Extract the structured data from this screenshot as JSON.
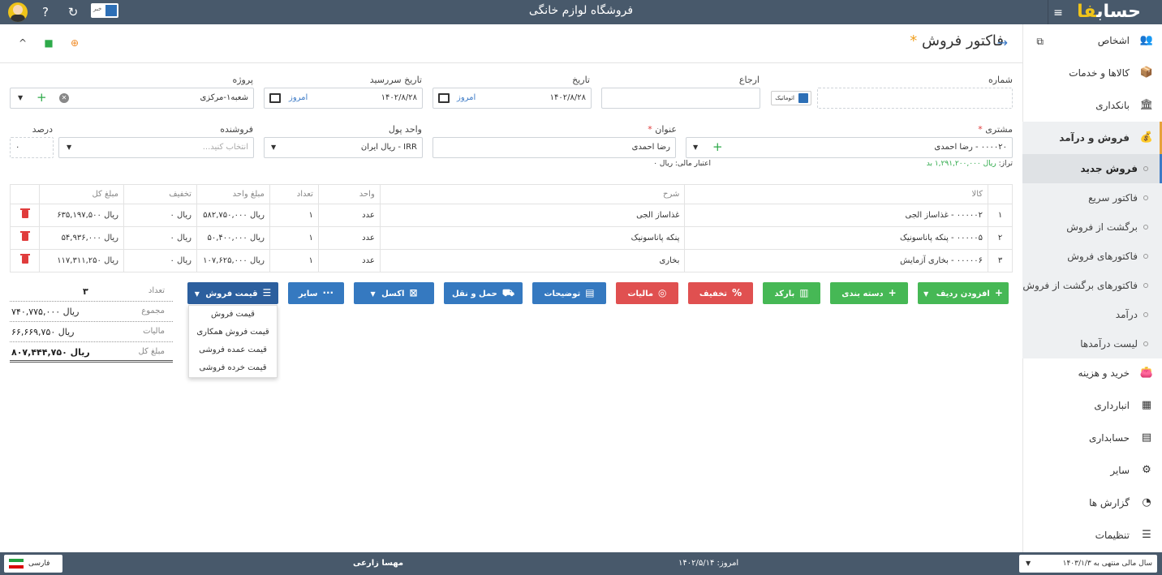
{
  "topbar": {
    "title": "فروشگاه لوازم خانگی",
    "logo": "حساب",
    "logo_highlight": "فا",
    "lang_badge": "خبر"
  },
  "sidebar": {
    "items": [
      {
        "label": "اشخاص",
        "icon": "people-icon"
      },
      {
        "label": "کالاها و خدمات",
        "icon": "box-icon"
      },
      {
        "label": "بانکداری",
        "icon": "bank-icon"
      },
      {
        "label": "فروش و درآمد",
        "icon": "sales-icon"
      },
      {
        "label": "خرید و هزینه",
        "icon": "wallet-icon"
      },
      {
        "label": "انبارداری",
        "icon": "warehouse-icon"
      },
      {
        "label": "حسابداری",
        "icon": "ledger-icon"
      },
      {
        "label": "سایر",
        "icon": "robot-icon"
      },
      {
        "label": "گزارش ها",
        "icon": "chart-icon"
      },
      {
        "label": "تنظیمات",
        "icon": "sliders-icon"
      }
    ],
    "sub": [
      "فروش جدید",
      "فاکتور سریع",
      "برگشت از فروش",
      "فاکتورهای فروش",
      "فاکتورهای برگشت از فروش",
      "درآمد",
      "لیست درآمدها"
    ]
  },
  "page": {
    "title": "فاکتور فروش",
    "star": "*"
  },
  "form": {
    "number_label": "شماره",
    "ref_label": "ارجاع",
    "auto_label": "اتوماتیک",
    "date_label": "تاریخ",
    "date_value": "۱۴۰۲/۸/۲۸",
    "today": "امروز",
    "due_label": "تاریخ سررسید",
    "due_value": "۱۴۰۲/۸/۲۸",
    "project_label": "پروژه",
    "project_value": "شعبه۱-مرکزی",
    "customer_label": "مشتری",
    "customer_value": "۰۰۰۰۲۰ - رضا احمدی",
    "balance_prefix": "تراز:",
    "balance_value": "ریال ۱,۲۹۱,۲۰۰,۰۰۰ بد",
    "credit": "اعتبار مالی: ریال ۰",
    "subject_label": "عنوان",
    "subject_value": "رضا احمدی",
    "currency_label": "واحد پول",
    "currency_value": "IRR - ریال ایران",
    "seller_label": "فروشنده",
    "seller_placeholder": "انتخاب کنید...",
    "percent_label": "درصد",
    "percent_value": "۰"
  },
  "table": {
    "headers": [
      "",
      "کالا",
      "شرح",
      "واحد",
      "تعداد",
      "مبلغ واحد",
      "تخفیف",
      "مبلغ کل",
      ""
    ],
    "rows": [
      [
        "۱",
        "۰۰۰۰۰۲ - غذاساز الجی",
        "غذاساز الجی",
        "عدد",
        "۱",
        "ریال ۵۸۲,۷۵۰,۰۰۰",
        "ریال ۰",
        "ریال ۶۳۵,۱۹۷,۵۰۰"
      ],
      [
        "۲",
        "۰۰۰۰۰۵ - پنکه پاناسونیک",
        "پنکه پاناسونیک",
        "عدد",
        "۱",
        "ریال ۵۰,۴۰۰,۰۰۰",
        "ریال ۰",
        "ریال ۵۴,۹۳۶,۰۰۰"
      ],
      [
        "۳",
        "۰۰۰۰۰۶ - بخاری آزمایش",
        "بخاری",
        "عدد",
        "۱",
        "ریال ۱۰۷,۶۲۵,۰۰۰",
        "ریال ۰",
        "ریال ۱۱۷,۳۱۱,۲۵۰"
      ]
    ]
  },
  "buttons": {
    "add_row": "افزودن ردیف",
    "category": "دسته بندی",
    "barcode": "بارکد",
    "discount": "تخفیف",
    "tax": "مالیات",
    "notes": "توضیحات",
    "shipping": "حمل و نقل",
    "excel": "اکسل",
    "other": "سایر",
    "price": "قیمت فروش"
  },
  "price_menu": [
    "قیمت فروش",
    "قیمت فروش همکاری",
    "قیمت عمده فروشی",
    "قیمت خرده فروشی"
  ],
  "totals": [
    {
      "label": "تعداد",
      "value": "۳"
    },
    {
      "label": "مجموع",
      "value": "ریال ۷۴۰,۷۷۵,۰۰۰"
    },
    {
      "label": "مالیات",
      "value": "ریال ۶۶,۶۶۹,۷۵۰"
    },
    {
      "label": "مبلغ کل",
      "value": "ریال ۸۰۷,۴۴۴,۷۵۰"
    }
  ],
  "footer": {
    "fiscal_year": "سال مالی منتهی به ۱۴۰۳/۱/۳",
    "today": "امروز: ۱۴۰۲/۵/۱۴",
    "user": "مهسا زارعی",
    "language": "فارسی"
  },
  "colors": {
    "bar": "#48596b",
    "green": "#46b855",
    "red": "#e05050",
    "blue": "#3579c0"
  }
}
